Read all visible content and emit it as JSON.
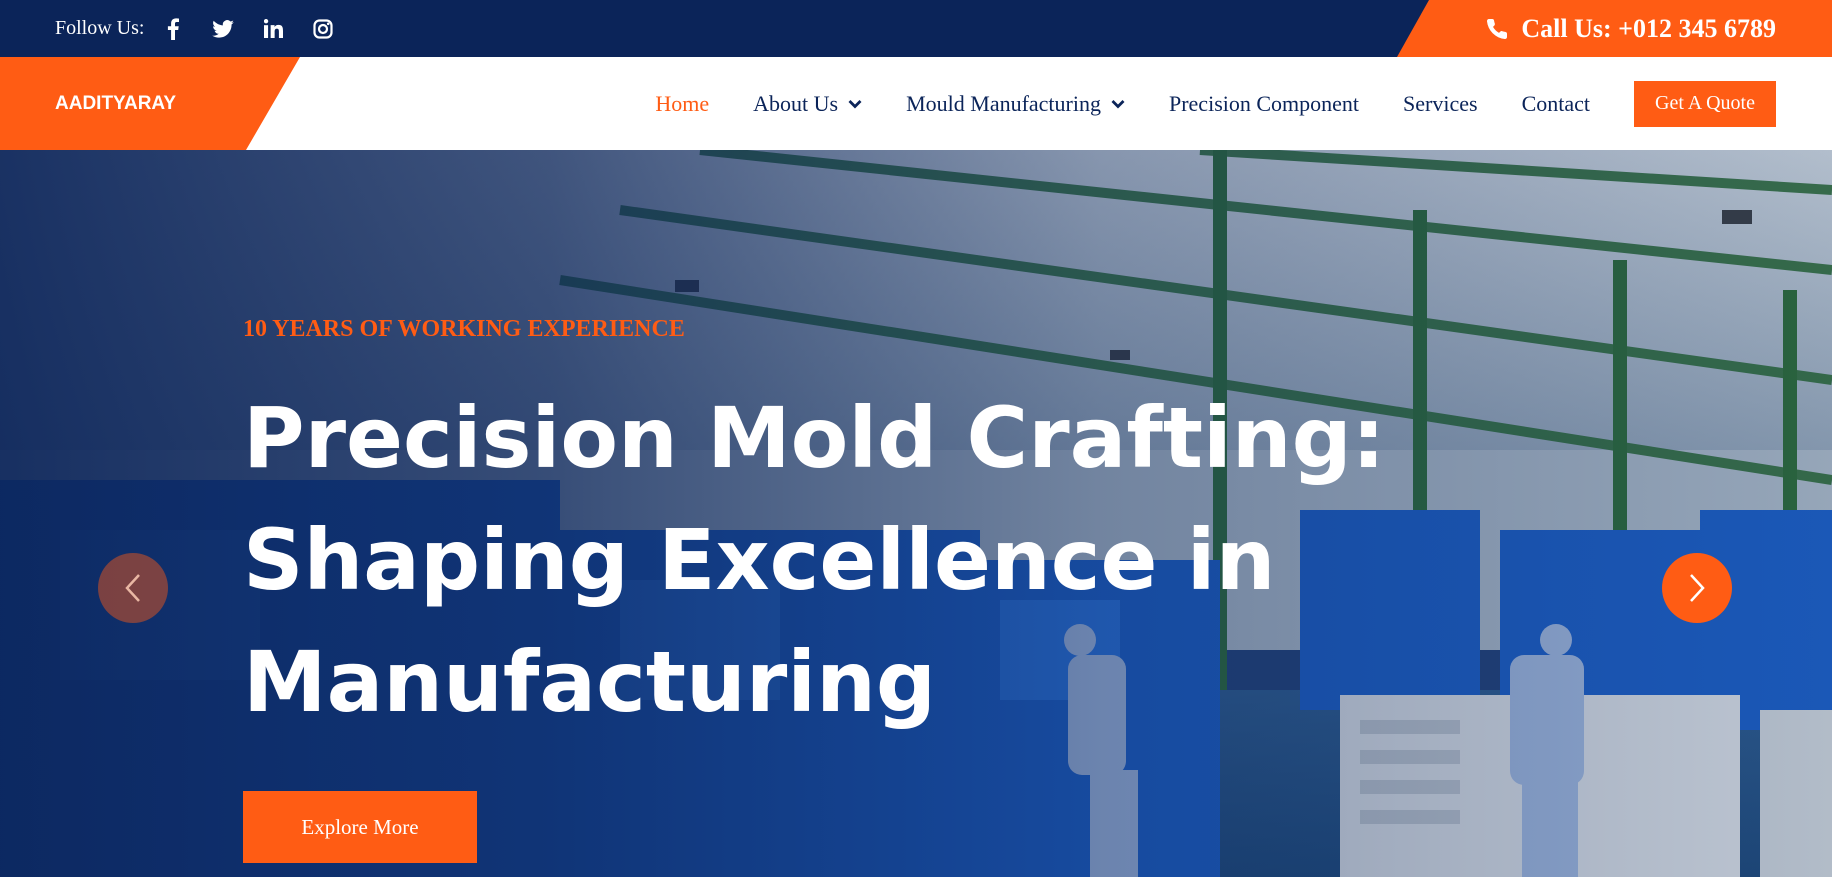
{
  "topbar": {
    "follow_label": "Follow Us:",
    "social_icons": [
      "facebook-icon",
      "twitter-icon",
      "linkedin-icon",
      "instagram-icon"
    ],
    "call_label": "Call Us: +012 345 6789"
  },
  "navbar": {
    "brand": "AADITYARAY",
    "items": [
      {
        "label": "Home",
        "active": true,
        "dropdown": false
      },
      {
        "label": "About Us",
        "active": false,
        "dropdown": true
      },
      {
        "label": "Mould Manufacturing",
        "active": false,
        "dropdown": true
      },
      {
        "label": "Precision Component",
        "active": false,
        "dropdown": false
      },
      {
        "label": "Services",
        "active": false,
        "dropdown": false
      },
      {
        "label": "Contact",
        "active": false,
        "dropdown": false
      }
    ],
    "cta": "Get A Quote"
  },
  "hero": {
    "eyebrow": "10 YEARS OF WORKING EXPERIENCE",
    "headline_lines": [
      "Precision Mold Crafting:",
      "Shaping Excellence in",
      "Manufacturing"
    ],
    "button": "Explore More",
    "prev_icon": "chevron-left-icon",
    "next_icon": "chevron-right-icon"
  },
  "colors": {
    "navy": "#0b2459",
    "accent": "#ff5c14",
    "white": "#ffffff"
  }
}
